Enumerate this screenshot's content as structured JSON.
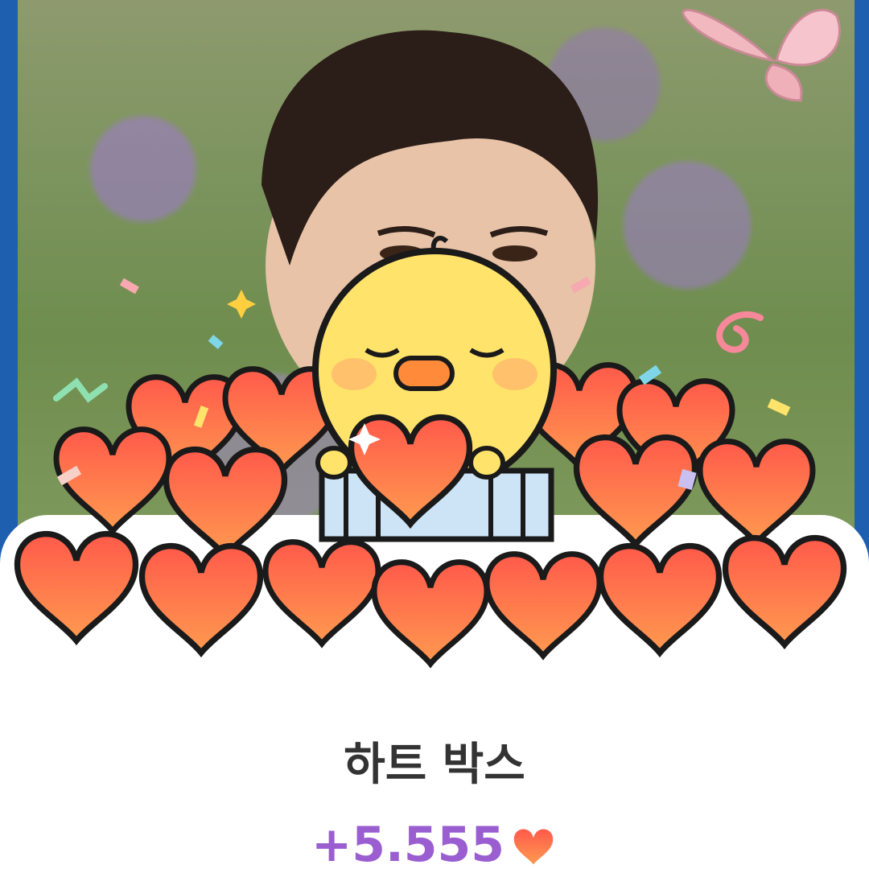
{
  "reward": {
    "title": "하트 박스",
    "amount": "+5.555"
  },
  "icons": {
    "amount_icon": "heart-icon",
    "mascot": "yellow-chick-mascot",
    "decoration": "butterfly-icon"
  },
  "colors": {
    "title": "#333333",
    "amount": "#9a5ed0",
    "heart_top": "#ff5a4a",
    "heart_bottom": "#ff9a50",
    "frame": "#1f5fb0"
  }
}
